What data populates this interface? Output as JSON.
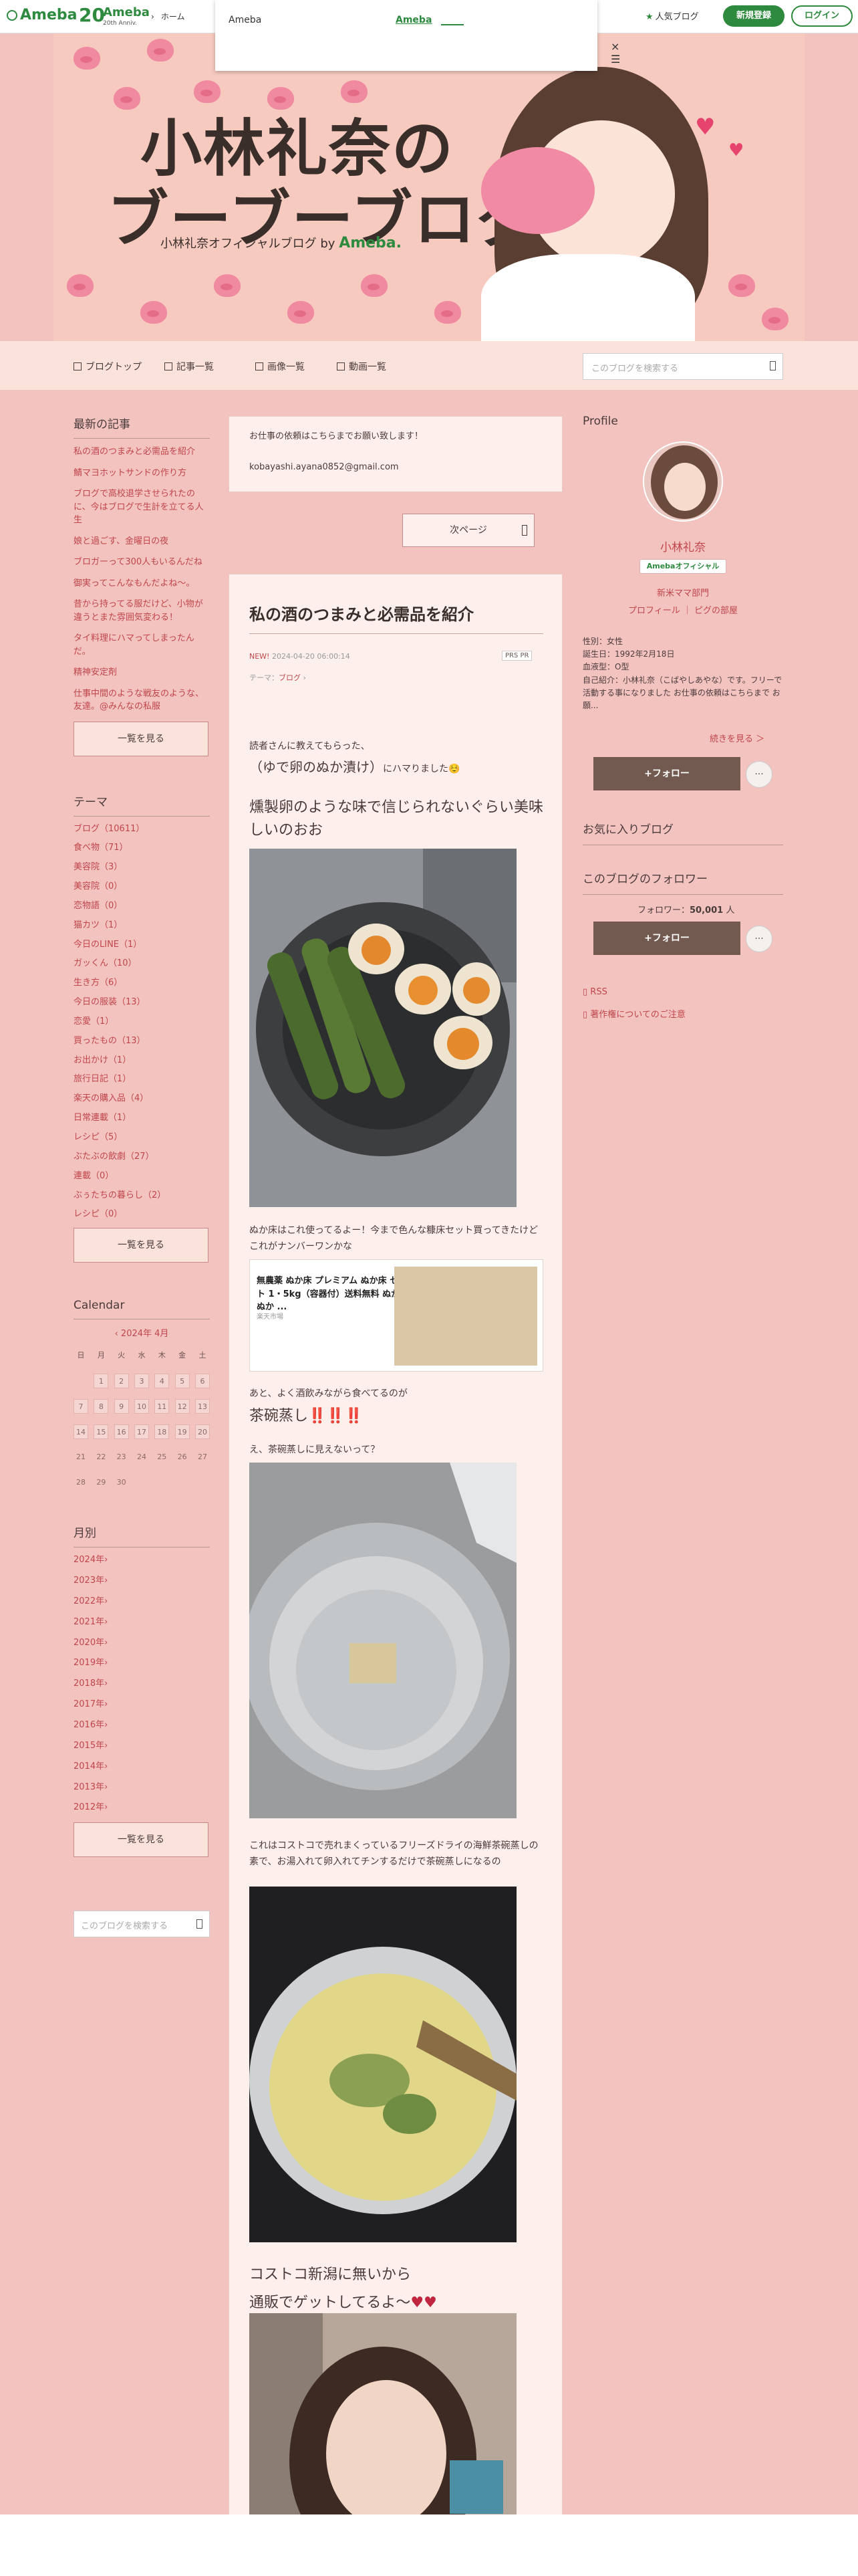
{
  "topbar": {
    "logo": "Ameba",
    "anniversary_number": "20",
    "anniversary_brand": "Ameba",
    "anniversary_sub": "20th Anniv.",
    "nav_home": "ホーム",
    "popular": "人気ブログ",
    "signup": "新規登録",
    "login": "ログイン"
  },
  "popup": {
    "label": "Ameba",
    "link": "Ameba",
    "close": "×"
  },
  "header": {
    "title_line1": "小林礼奈の",
    "title_line2": "ブーブーブログ",
    "subtitle": "小林礼奈オフィシャルブログ by",
    "subtitle_brand": "Ameba."
  },
  "subnav": {
    "items": [
      "ブログトップ",
      "記事一覧",
      "画像一覧",
      "動画一覧"
    ],
    "search_placeholder": "このブログを検索する"
  },
  "left": {
    "recent_title": "最新の記事",
    "recent": [
      "私の酒のつまみと必需品を紹介",
      "鯖マヨホットサンドの作り方",
      "ブログで高校退学させられたのに、今はブログで生計を立てる人生",
      "娘と過ごす、金曜日の夜",
      "ブロガーって300人もいるんだね",
      "御実ってこんなもんだよね〜。",
      "昔から持ってる服だけど、小物が違うとまた雰囲気変わる！",
      "タイ料理にハマってしまったんだ。",
      "精神安定剤",
      "仕事中間のような戦友のような、友達。@みんなの私服"
    ],
    "recent_more": "一覧を見る",
    "theme_title": "テーマ",
    "themes": [
      "ブログ（10611）",
      "食べ物（71）",
      "美容院（3）",
      "美容院（0）",
      "恋物語（0）",
      "猫カツ（1）",
      "今日のLINE（1）",
      "ガッくん（10）",
      "生き方（6）",
      "今日の服装（13）",
      "恋愛（1）",
      "買ったもの（13）",
      "お出かけ（1）",
      "旅行日記（1）",
      "楽天の購入品（4）",
      "日常連載（1）",
      "レシピ（5）",
      "ぶたぶの飲劇（27）",
      "連載（0）",
      "ぶぅたちの暮らし（2）",
      "レシピ（0）"
    ],
    "theme_more": "一覧を見る",
    "calendar_title": "Calendar",
    "calendar_month": "2024年 4月",
    "dow": [
      "日",
      "月",
      "火",
      "水",
      "木",
      "金",
      "土"
    ],
    "weeks": [
      [
        "",
        "1",
        "2",
        "3",
        "4",
        "5",
        "6"
      ],
      [
        "7",
        "8",
        "9",
        "10",
        "11",
        "12",
        "13"
      ],
      [
        "14",
        "15",
        "16",
        "17",
        "18",
        "19",
        "20"
      ],
      [
        "21",
        "22",
        "23",
        "24",
        "25",
        "26",
        "27"
      ],
      [
        "28",
        "29",
        "30",
        "",
        "",
        "",
        ""
      ]
    ],
    "monthly_title": "月別",
    "years": [
      "2024年",
      "2023年",
      "2022年",
      "2021年",
      "2020年",
      "2019年",
      "2018年",
      "2017年",
      "2016年",
      "2015年",
      "2014年",
      "2013年",
      "2012年"
    ],
    "monthly_more": "一覧を見る",
    "search_placeholder": "このブログを検索する"
  },
  "main": {
    "notice_line1": "お仕事の依頼はこちらまでお願い致します！",
    "notice_line2": "kobayashi.ayana0852@gmail.com",
    "next_page": "次ページ",
    "article": {
      "title": "私の酒のつまみと必需品を紹介",
      "new": "NEW!",
      "date": "2024-04-20 06:00:14",
      "pr": "PRS PR",
      "theme_label": "テーマ：",
      "theme": "ブログ",
      "p1": "読者さんに教えてもらった、",
      "p2": "（ゆで卵のぬか漬け）",
      "p2b": "にハマりました☺️",
      "p3": "燻製卵のような味で信じられないぐらい美味しいのおお",
      "p4": "ぬか床はこれ使ってるよー！今まで色んな糠床セット買ってきたけどこれがナンバーワンかな",
      "link_title": "無農薬 ぬか床 プレミアム ぬか床 セット 1・5kg（容器付）送料無料 ぬか床 ぬか ...",
      "link_source": "楽天市場",
      "p5": "あと、よく酒飲みながら食べてるのが",
      "p6": "茶碗蒸し",
      "p6_mark": "‼️‼️‼️",
      "p7": "え、茶碗蒸しに見えないって？",
      "p8": "これはコストコで売れまくっているフリーズドライの海鮮茶碗蒸しの素で、お湯入れて卵入れてチンするだけで茶碗蒸しになるの",
      "p9": "コストコ新潟に無いから",
      "p10": "通販でゲットしてるよ〜",
      "p10_mark": "♥♥"
    }
  },
  "right": {
    "profile_title": "Profile",
    "name": "小林礼奈",
    "official": "Amebaオフィシャル",
    "category": "新米ママ部門",
    "link_profile": "プロフィール",
    "link_pig": "ピグの部屋",
    "info_1": "性別：女性",
    "info_2": "誕生日：1992年2月18日",
    "info_3": "血液型：O型",
    "info_4": "自己紹介：小林礼奈（こばやしあやな）です。フリーで活動する事になりました お仕事の依頼はこちらまで お願...",
    "read_more": "続きを見る ＞",
    "follow": "+フォロー",
    "dots": "···",
    "fav_title": "お気に入りブログ",
    "follower_title": "このブログのフォロワー",
    "follower_label": "フォロワー：",
    "follower_count": "50,001",
    "follower_unit": "人",
    "follow2": "+フォロー",
    "dots2": "···",
    "rss": "RSS",
    "copyright": "著作権についてのご注意"
  },
  "colors": {
    "background": "#f3c3c0",
    "accent_red": "#c0464b",
    "ameba_green": "#2d8a3e",
    "follow_brown": "#735a50"
  }
}
